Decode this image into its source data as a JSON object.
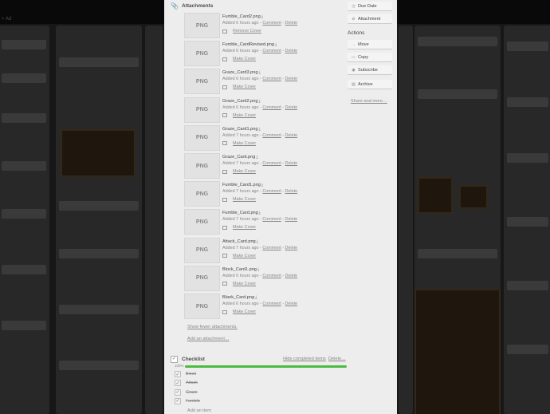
{
  "board": {
    "corner_label": "+ Ad"
  },
  "attachments_section": {
    "title": "Attachments",
    "items": [
      {
        "name": "Fumble_Card2.png",
        "added": "Added 6 hours ago",
        "comment": "Comment",
        "delete": "Delete",
        "cover_action": "Remove Cover",
        "thumb": "PNG"
      },
      {
        "name": "Fumble_CardRevised.png",
        "added": "Added 6 hours ago",
        "comment": "Comment",
        "delete": "Delete",
        "cover_action": "Make Cover",
        "thumb": "PNG"
      },
      {
        "name": "Graze_Card3.png",
        "added": "Added 6 hours ago",
        "comment": "Comment",
        "delete": "Delete",
        "cover_action": "Make Cover",
        "thumb": "PNG"
      },
      {
        "name": "Graze_Card2.png",
        "added": "Added 6 hours ago",
        "comment": "Comment",
        "delete": "Delete",
        "cover_action": "Make Cover",
        "thumb": "PNG"
      },
      {
        "name": "Graze_Card1.png",
        "added": "Added 7 hours ago",
        "comment": "Comment",
        "delete": "Delete",
        "cover_action": "Make Cover",
        "thumb": "PNG"
      },
      {
        "name": "Graze_Card.png",
        "added": "Added 7 hours ago",
        "comment": "Comment",
        "delete": "Delete",
        "cover_action": "Make Cover",
        "thumb": "PNG"
      },
      {
        "name": "Fumble_Card1.png",
        "added": "Added 7 hours ago",
        "comment": "Comment",
        "delete": "Delete",
        "cover_action": "Make Cover",
        "thumb": "PNG"
      },
      {
        "name": "Fumble_Card.png",
        "added": "Added 7 hours ago",
        "comment": "Comment",
        "delete": "Delete",
        "cover_action": "Make Cover",
        "thumb": "PNG"
      },
      {
        "name": "Attack_Card.png",
        "added": "Added 7 hours ago",
        "comment": "Comment",
        "delete": "Delete",
        "cover_action": "Make Cover",
        "thumb": "PNG"
      },
      {
        "name": "Block_Card1.png",
        "added": "Added 6 hours ago",
        "comment": "Comment",
        "delete": "Delete",
        "cover_action": "Make Cover",
        "thumb": "PNG"
      },
      {
        "name": "Blank_Card.png",
        "added": "Added 6 hours ago",
        "comment": "Comment",
        "delete": "Delete",
        "cover_action": "Make Cover",
        "thumb": "PNG"
      }
    ],
    "show_fewer": "Show fewer attachments.",
    "add_attachment": "Add an attachment…"
  },
  "checklist": {
    "title": "Checklist",
    "hide_completed": "Hide completed items",
    "delete": "Delete…",
    "percent_label": "100%",
    "progress": 1.0,
    "items": [
      "Block",
      "Attack",
      "Graze",
      "Fumble"
    ],
    "add_item": "Add an item"
  },
  "sidebar": {
    "due_date": "Due Date",
    "attachment": "Attachment",
    "actions_title": "Actions",
    "move": "Move",
    "copy": "Copy",
    "subscribe": "Subscribe",
    "archive": "Archive",
    "more": "Share and more…"
  },
  "colors": {
    "accent_green": "#4cbb3f",
    "modal_bg": "#ededed"
  }
}
